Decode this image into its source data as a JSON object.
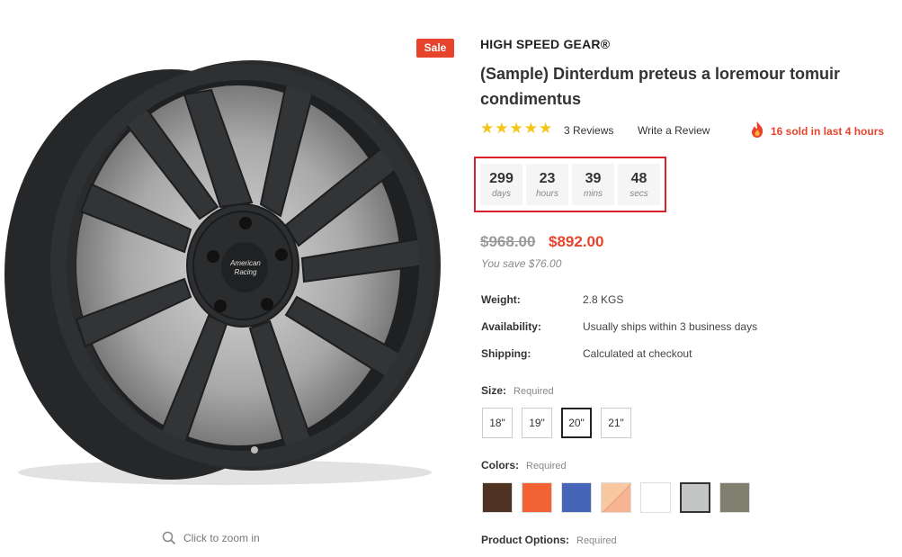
{
  "product": {
    "sale_badge": "Sale",
    "zoom_hint": "Click to zoom in",
    "wheel_logo_line1": "American",
    "wheel_logo_line2": "Racing",
    "brand": "HIGH SPEED GEAR®",
    "title": "(Sample) Dinterdum preteus a loremour tomuir condimentus",
    "rating": {
      "stars": "★★★★★",
      "value": 5,
      "reviews_label": "3 Reviews",
      "write_review_label": "Write a Review"
    },
    "sold_notice": "16 sold in last 4 hours",
    "countdown": [
      {
        "value": "299",
        "unit": "days"
      },
      {
        "value": "23",
        "unit": "hours"
      },
      {
        "value": "39",
        "unit": "mins"
      },
      {
        "value": "48",
        "unit": "secs"
      }
    ],
    "price": {
      "old": "$968.00",
      "new": "$892.00",
      "savings": "You save $76.00"
    },
    "specs": [
      {
        "label": "Weight:",
        "value": "2.8 KGS"
      },
      {
        "label": "Availability:",
        "value": "Usually ships within 3 business days"
      },
      {
        "label": "Shipping:",
        "value": "Calculated at checkout"
      }
    ],
    "size_option": {
      "label": "Size:",
      "required": "Required",
      "options": [
        "18\"",
        "19\"",
        "20\"",
        "21\""
      ],
      "selected_index": 2
    },
    "color_option": {
      "label": "Colors:",
      "required": "Required",
      "swatches": [
        "#4e3322",
        "#f26232",
        "#4765b8",
        "#f8c9a0/#f7b593",
        "#ffffff",
        "#c4c6c6",
        "#807f70"
      ],
      "selected_index": 5
    },
    "product_options": {
      "label": "Product Options:",
      "required": "Required"
    }
  },
  "colors": {
    "accent_red": "#e8432d",
    "countdown_border": "#d8212b",
    "star_yellow": "#f5c518"
  },
  "icons": {
    "zoom": "magnifier-icon",
    "fire": "fire-icon",
    "star": "star-icon"
  }
}
